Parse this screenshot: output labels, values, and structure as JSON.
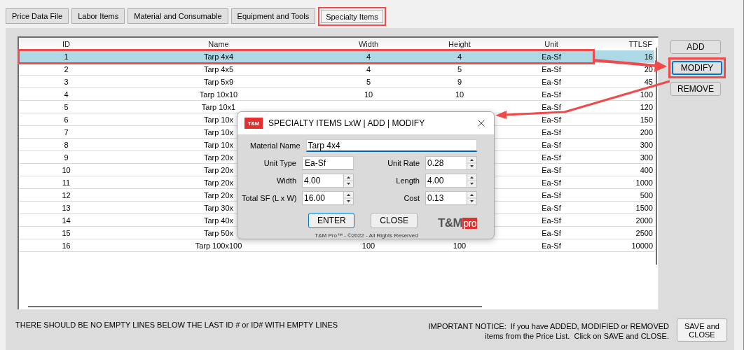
{
  "tabs": [
    {
      "label": "Price Data File",
      "selected": false,
      "highlighted": false
    },
    {
      "label": "Labor Items",
      "selected": false,
      "highlighted": false
    },
    {
      "label": "Material and Consumable",
      "selected": false,
      "highlighted": false
    },
    {
      "label": "Equipment and Tools",
      "selected": false,
      "highlighted": false
    },
    {
      "label": "Specialty Items",
      "selected": true,
      "highlighted": true
    }
  ],
  "table": {
    "columns": [
      "ID",
      "Name",
      "Width",
      "Height",
      "Unit",
      "TTLSF"
    ],
    "rows": [
      {
        "cells": [
          "1",
          "Tarp 4x4",
          "4",
          "4",
          "Ea-Sf",
          "16"
        ],
        "selected": true,
        "highlighted": true
      },
      {
        "cells": [
          "2",
          "Tarp 4x5",
          "4",
          "5",
          "Ea-Sf",
          "20"
        ],
        "selected": false,
        "highlighted": false
      },
      {
        "cells": [
          "3",
          "Tarp 5x9",
          "5",
          "9",
          "Ea-Sf",
          "45"
        ],
        "selected": false,
        "highlighted": false
      },
      {
        "cells": [
          "4",
          "Tarp 10x10",
          "10",
          "10",
          "Ea-Sf",
          "100"
        ],
        "selected": false,
        "highlighted": false
      },
      {
        "cells": [
          "5",
          "Tarp 10x1",
          null,
          null,
          "Ea-Sf",
          "120"
        ],
        "selected": false,
        "highlighted": false
      },
      {
        "cells": [
          "6",
          "Tarp 10x",
          null,
          null,
          "Ea-Sf",
          "150"
        ],
        "selected": false,
        "highlighted": false
      },
      {
        "cells": [
          "7",
          "Tarp 10x",
          null,
          null,
          "Ea-Sf",
          "200"
        ],
        "selected": false,
        "highlighted": false
      },
      {
        "cells": [
          "8",
          "Tarp 10x",
          null,
          null,
          "Ea-Sf",
          "300"
        ],
        "selected": false,
        "highlighted": false
      },
      {
        "cells": [
          "9",
          "Tarp 20x",
          null,
          null,
          "Ea-Sf",
          "300"
        ],
        "selected": false,
        "highlighted": false
      },
      {
        "cells": [
          "10",
          "Tarp 20x",
          null,
          null,
          "Ea-Sf",
          "400"
        ],
        "selected": false,
        "highlighted": false
      },
      {
        "cells": [
          "11",
          "Tarp 20x",
          null,
          null,
          "Ea-Sf",
          "1000"
        ],
        "selected": false,
        "highlighted": false
      },
      {
        "cells": [
          "12",
          "Tarp 20x",
          null,
          null,
          "Ea-Sf",
          "500"
        ],
        "selected": false,
        "highlighted": false
      },
      {
        "cells": [
          "13",
          "Tarp 30x",
          null,
          null,
          "Ea-Sf",
          "1500"
        ],
        "selected": false,
        "highlighted": false
      },
      {
        "cells": [
          "14",
          "Tarp 40x",
          null,
          null,
          "Ea-Sf",
          "2000"
        ],
        "selected": false,
        "highlighted": false
      },
      {
        "cells": [
          "15",
          "Tarp 50x",
          null,
          null,
          "Ea-Sf",
          "2500"
        ],
        "selected": false,
        "highlighted": false
      },
      {
        "cells": [
          "16",
          "Tarp 100x100",
          "100",
          "100",
          "Ea-Sf",
          "10000"
        ],
        "selected": false,
        "highlighted": false
      }
    ]
  },
  "side_buttons": [
    {
      "label": "ADD",
      "highlighted": false,
      "focused": false
    },
    {
      "label": "MODIFY",
      "highlighted": true,
      "focused": true
    },
    {
      "label": "REMOVE",
      "highlighted": false,
      "focused": false
    }
  ],
  "footer": {
    "note": "THERE SHOULD BE NO EMPTY LINES BELOW THE LAST ID # or ID# WITH EMPTY LINES",
    "notice": "IMPORTANT NOTICE:  If you have ADDED, MODIFIED or REMOVED\nitems from the Price List.  Click on SAVE and CLOSE.",
    "save_button": "SAVE and\nCLOSE"
  },
  "dialog": {
    "logo_text": "T&M",
    "title": "SPECIALTY ITEMS LxW | ADD | MODIFY",
    "material_name": {
      "label": "Material Name",
      "value": "Tarp 4x4"
    },
    "fields": [
      {
        "label": "Unit Type",
        "value": "Ea-Sf",
        "kind": "text"
      },
      {
        "label": "Unit Rate",
        "value": "0.28",
        "kind": "spin"
      },
      {
        "label": "Width",
        "value": "4.00",
        "kind": "spin"
      },
      {
        "label": "Length",
        "value": "4.00",
        "kind": "spin"
      },
      {
        "label": "Total SF (L x W)",
        "value": "16.00",
        "kind": "spin"
      },
      {
        "label": "Cost",
        "value": "0.13",
        "kind": "spin"
      }
    ],
    "buttons": [
      {
        "label": "ENTER",
        "focused": true
      },
      {
        "label": "CLOSE",
        "focused": false
      }
    ],
    "brand": {
      "main": "T&M",
      "accent": "pro"
    },
    "copyright": "T&M Pro™ - ©2022 - All Rights Reserved"
  }
}
